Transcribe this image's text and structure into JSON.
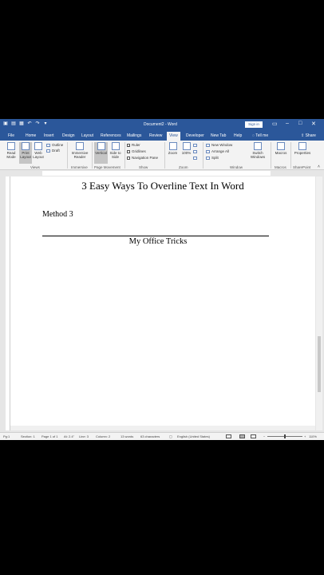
{
  "titlebar": {
    "qat_icons": [
      "autosave-icon",
      "save-icon",
      "undo-icon",
      "redo-icon"
    ],
    "title": "Document2 - Word",
    "signin": "Sign in"
  },
  "tabs": [
    "File",
    "Home",
    "Insert",
    "Design",
    "Layout",
    "References",
    "Mailings",
    "Review",
    "View",
    "Developer",
    "New Tab",
    "Help"
  ],
  "tabs_active": "View",
  "tell_me": "Tell me",
  "share": "Share",
  "ribbon": {
    "read_mode": "Read Mode",
    "print_layout": "Print Layout",
    "web_layout": "Web Layout",
    "outline": "Outline",
    "draft": "Draft",
    "views_group": "Views",
    "immersive_reader": "Immersive Reader",
    "immersive_group": "Immersive",
    "vertical": "Vertical",
    "side_to_side": "Side to Side",
    "page_movement_group": "Page Movement",
    "ruler": "Ruler",
    "gridlines": "Gridlines",
    "navigation_pane": "Navigation Pane",
    "show_group": "Show",
    "zoom": "Zoom",
    "zoom_100": "100%",
    "zoom_group": "Zoom",
    "new_window": "New Window",
    "arrange_all": "Arrange All",
    "split": "Split",
    "switch_windows": "Switch Windows",
    "window_group": "Window",
    "macros": "Macros",
    "macros_group": "Macros",
    "properties": "Properties",
    "sharepoint_group": "SharePoint"
  },
  "document": {
    "title": "3 Easy Ways To Overline Text In Word",
    "method": "Method 3",
    "footer_text": "My Office Tricks"
  },
  "status": {
    "page_num": "Pg:1",
    "section": "Section: 1",
    "page": "Page 1 of 1",
    "at": "At: 2.4\"",
    "line": "Line: 3",
    "column": "Column: 2",
    "words": "13 words",
    "characters": "63 characters",
    "language": "English (United States)",
    "zoom": "110%"
  }
}
